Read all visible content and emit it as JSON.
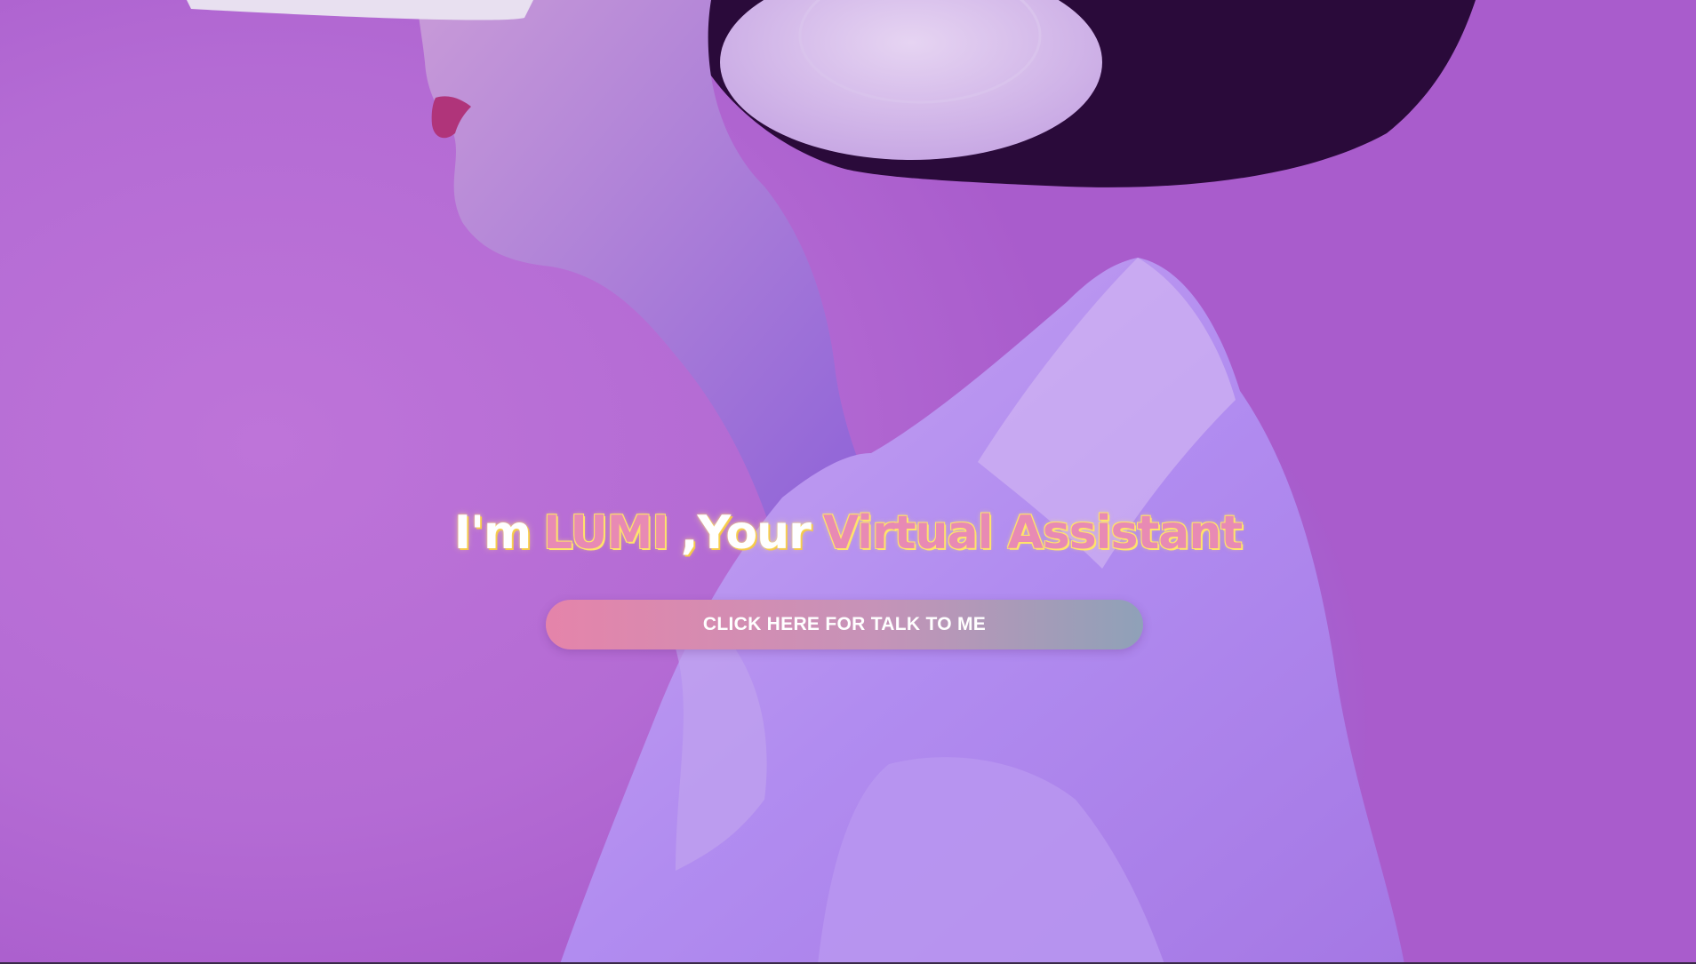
{
  "hero": {
    "image_description": "profile of woman wearing white VR headset and headphones, white top, purple background",
    "background_color": "#b86fd6"
  },
  "headline": {
    "prefix": "I'm",
    "name": "LUMI",
    "middle": ",Your",
    "suffix": "Virtual Assistant",
    "accent_color": "#e88ab4",
    "outline_color": "#ffe36a"
  },
  "cta": {
    "label": "CLICK HERE FOR TALK TO ME",
    "gradient_start": "#e584aa",
    "gradient_end": "#8fa1b8"
  }
}
